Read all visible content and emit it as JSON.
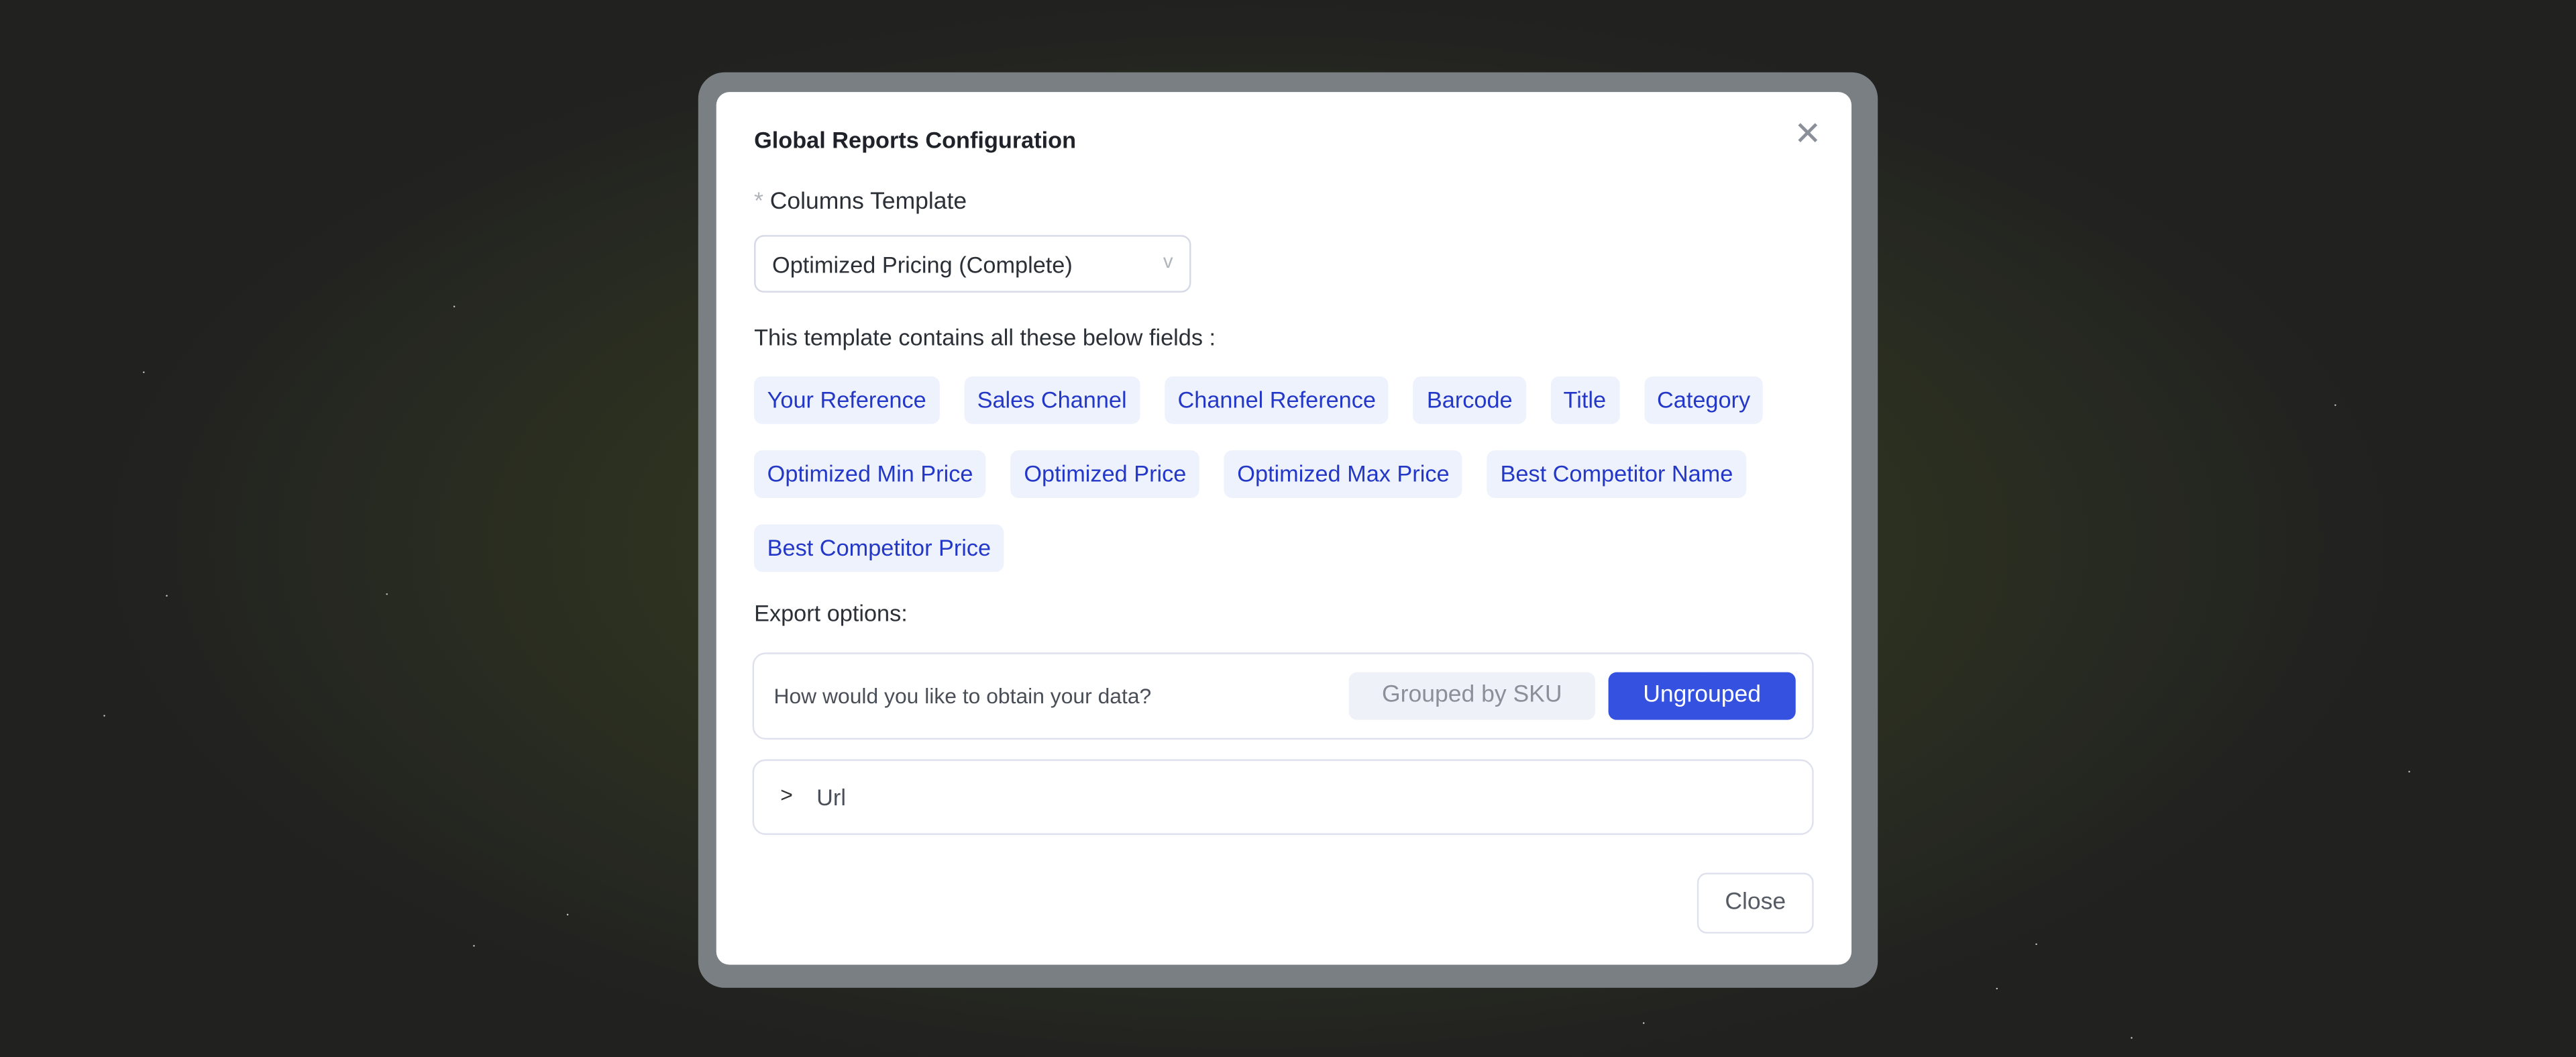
{
  "dialog": {
    "title": "Global Reports Configuration",
    "close_icon": "close-x-icon"
  },
  "columns_template": {
    "required_mark": "*",
    "label": "Columns Template",
    "selected": "Optimized Pricing (Complete)",
    "chevron": "v"
  },
  "fields": {
    "label": "This template contains all these below fields :",
    "items": [
      "Your Reference",
      "Sales Channel",
      "Channel Reference",
      "Barcode",
      "Title",
      "Category",
      "Optimized Min Price",
      "Optimized Price",
      "Optimized Max Price",
      "Best Competitor Name",
      "Best Competitor Price"
    ]
  },
  "export": {
    "label": "Export options:",
    "question": "How would you like to obtain your data?",
    "options": [
      "Grouped by SKU",
      "Ungrouped"
    ],
    "selected": "Ungrouped"
  },
  "url": {
    "chevron": ">",
    "label": "Url"
  },
  "footer": {
    "close_label": "Close"
  },
  "colors": {
    "accent": "#3451e0",
    "tag_text": "#2438c8",
    "tag_bg": "#eef2fd"
  }
}
